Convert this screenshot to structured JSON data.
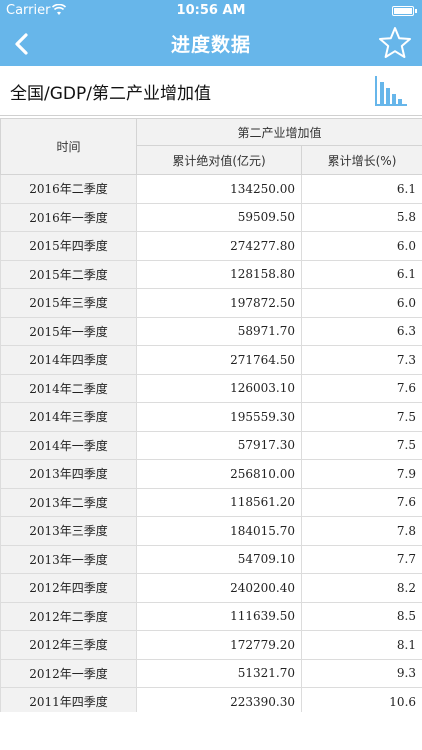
{
  "status_bar": {
    "carrier": "Carrier",
    "time": "10:56 AM"
  },
  "nav": {
    "title": "进度数据",
    "back_icon": "chevron-left-icon",
    "favorite_icon": "star-outline-icon",
    "bar_color": "#67b6ea"
  },
  "subheader": {
    "path": "全国/GDP/第二产业增加值",
    "chart_icon": "bar-chart-icon"
  },
  "table": {
    "time_header": "时间",
    "group_header": "第二产业增加值",
    "col_value": "累计绝对值(亿元)",
    "col_growth": "累计增长(%)",
    "rows": [
      {
        "period": "2016年二季度",
        "value": "134250.00",
        "growth": "6.1"
      },
      {
        "period": "2016年一季度",
        "value": "59509.50",
        "growth": "5.8"
      },
      {
        "period": "2015年四季度",
        "value": "274277.80",
        "growth": "6.0"
      },
      {
        "period": "2015年二季度",
        "value": "128158.80",
        "growth": "6.1"
      },
      {
        "period": "2015年三季度",
        "value": "197872.50",
        "growth": "6.0"
      },
      {
        "period": "2015年一季度",
        "value": "58971.70",
        "growth": "6.3"
      },
      {
        "period": "2014年四季度",
        "value": "271764.50",
        "growth": "7.3"
      },
      {
        "period": "2014年二季度",
        "value": "126003.10",
        "growth": "7.6"
      },
      {
        "period": "2014年三季度",
        "value": "195559.30",
        "growth": "7.5"
      },
      {
        "period": "2014年一季度",
        "value": "57917.30",
        "growth": "7.5"
      },
      {
        "period": "2013年四季度",
        "value": "256810.00",
        "growth": "7.9"
      },
      {
        "period": "2013年二季度",
        "value": "118561.20",
        "growth": "7.6"
      },
      {
        "period": "2013年三季度",
        "value": "184015.70",
        "growth": "7.8"
      },
      {
        "period": "2013年一季度",
        "value": "54709.10",
        "growth": "7.7"
      },
      {
        "period": "2012年四季度",
        "value": "240200.40",
        "growth": "8.2"
      },
      {
        "period": "2012年二季度",
        "value": "111639.50",
        "growth": "8.5"
      },
      {
        "period": "2012年三季度",
        "value": "172779.20",
        "growth": "8.1"
      },
      {
        "period": "2012年一季度",
        "value": "51321.70",
        "growth": "9.3"
      },
      {
        "period": "2011年四季度",
        "value": "223390.30",
        "growth": "10.6"
      }
    ]
  }
}
